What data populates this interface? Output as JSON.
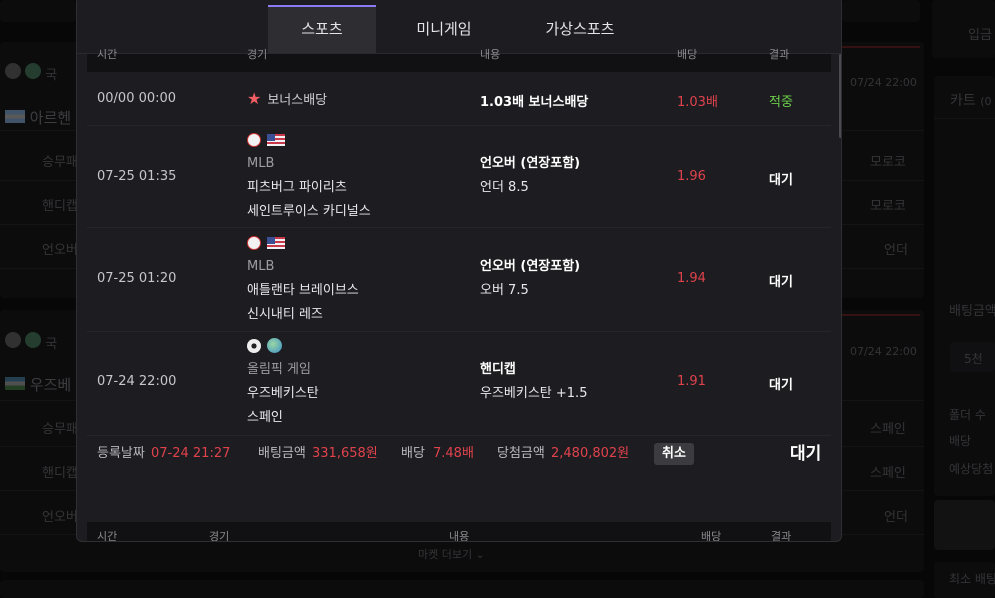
{
  "background": {
    "left_cards": [
      {
        "country": "아르헨",
        "title_fragment": "국",
        "time": "07/24 22:00",
        "rows": [
          "승무패",
          "핸디캡",
          "언오버"
        ],
        "right_values": [
          "모로코",
          "모로코",
          "언더"
        ]
      },
      {
        "country": "우즈베",
        "title_fragment": "국",
        "time": "07/24 22:00",
        "rows": [
          "승무패",
          "핸디캡",
          "언오버"
        ],
        "right_values": [
          "스페인",
          "스페인",
          "언더"
        ]
      }
    ],
    "more_markets": "마켓 더보기",
    "right_panel": {
      "deposit_button": "입금",
      "cart_title": "카트",
      "cart_count_fragment": "(0",
      "bet_amount_label": "배팅금액",
      "amount_option": "5천",
      "folder_count_label": "폴더 수",
      "odds_label": "배당",
      "expected_win_label": "예상당첨",
      "min_bet_label": "최소 배팅"
    }
  },
  "modal": {
    "tabs": [
      {
        "label": "스포츠",
        "active": true
      },
      {
        "label": "미니게임",
        "active": false
      },
      {
        "label": "가상스포츠",
        "active": false
      }
    ],
    "columns": {
      "time": "시간",
      "game": "경기",
      "content": "내용",
      "odds": "배당",
      "result": "결과"
    },
    "bets": [
      {
        "time": "00/00 00:00",
        "bonus": true,
        "bonus_label": "보너스배당",
        "market": "1.03배 보너스배당",
        "odds": "1.03배",
        "result": "적중",
        "result_type": "won"
      },
      {
        "time": "07-25 01:35",
        "sport_icon": "baseball-icon",
        "flag_icon": "us-flag-icon",
        "league": "MLB",
        "home": "피츠버그 파이리츠",
        "away": "세인트루이스 카디널스",
        "market": "언오버 (연장포함)",
        "pick": "언더 8.5",
        "odds": "1.96",
        "result": "대기",
        "result_type": "wait"
      },
      {
        "time": "07-25 01:20",
        "sport_icon": "baseball-icon",
        "flag_icon": "us-flag-icon",
        "league": "MLB",
        "home": "애틀랜타 브레이브스",
        "away": "신시내티 레즈",
        "market": "언오버 (연장포함)",
        "pick": "오버 7.5",
        "odds": "1.94",
        "result": "대기",
        "result_type": "wait"
      },
      {
        "time": "07-24 22:00",
        "sport_icon": "soccer-icon",
        "flag_icon": "globe-icon",
        "league": "올림픽 게임",
        "home": "우즈베키스탄",
        "away": "스페인",
        "market": "핸디캡",
        "pick": "우즈베키스탄 +1.5",
        "odds": "1.91",
        "result": "대기",
        "result_type": "wait"
      }
    ],
    "summary": {
      "reg_date_label": "등록날짜",
      "reg_date": "07-24 21:27",
      "bet_amount_label": "배팅금액",
      "bet_amount": "331,658원",
      "odds_label": "배당",
      "odds": "7.48배",
      "win_amount_label": "당첨금액",
      "win_amount": "2,480,802원",
      "cancel_label": "취소",
      "status": "대기"
    },
    "next_columns": {
      "time": "시간",
      "game": "경기",
      "content": "내용",
      "odds": "배당",
      "result": "결과"
    }
  },
  "colors": {
    "accent": "#8b7cf6",
    "odds_red": "#e0424c",
    "won_green": "#6ccf4a"
  }
}
